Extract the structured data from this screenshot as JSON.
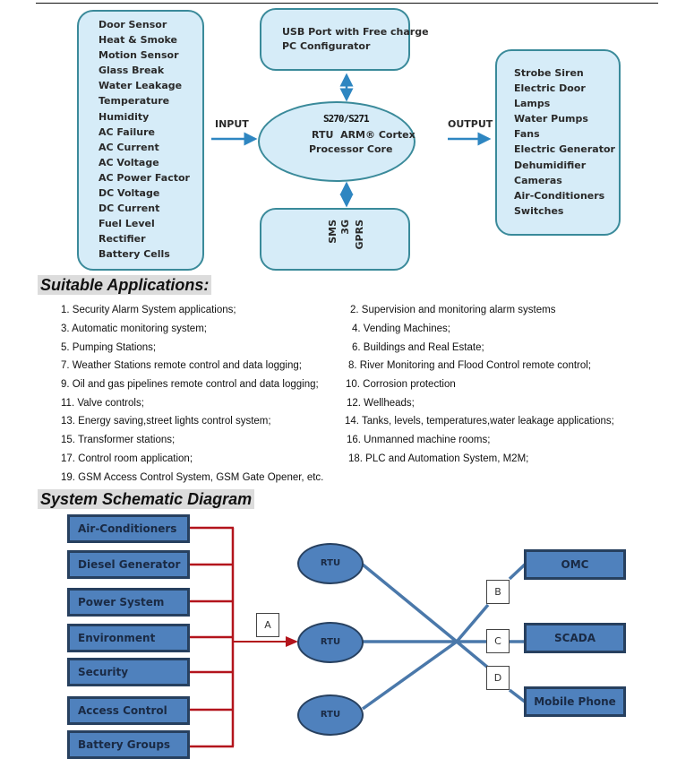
{
  "block_diagram": {
    "inputs": [
      "Door Sensor",
      "Heat & Smoke",
      "Motion Sensor",
      "Glass Break",
      "Water Leakage",
      "Temperature",
      "Humidity",
      "AC Failure",
      "AC Current",
      "AC Voltage",
      "AC Power Factor",
      "DC Voltage",
      "DC Current",
      "Fuel Level",
      "Rectifier",
      "Battery Cells"
    ],
    "input_label": "INPUT",
    "output_label": "OUTPUT",
    "usb_box": {
      "line1": "USB Port with Free charge",
      "line2": "PC Configurator"
    },
    "core": {
      "model": "S270/S271",
      "line2": "RTU  ARM® Cortex",
      "line3": "Processor Core"
    },
    "comm": [
      "GPRS",
      "3G",
      "SMS"
    ],
    "outputs": [
      "Strobe Siren",
      "Electric Door",
      "Lamps",
      "Water Pumps",
      "Fans",
      "Electric Generator",
      "Dehumidifier",
      "Cameras",
      "Air-Conditioners",
      "Switches"
    ],
    "colors": {
      "box_fill": "#d6ecf8",
      "box_border": "#3a8a9a",
      "arrow": "#2e86c1"
    }
  },
  "applications": {
    "title": "Suitable Applications:",
    "items": [
      "1. Security Alarm System applications;",
      "2. Supervision and monitoring alarm systems",
      "3. Automatic monitoring system;",
      "4. Vending Machines;",
      "5. Pumping Stations;",
      "6. Buildings and Real Estate;",
      "7. Weather Stations remote control and data logging;",
      "8. River Monitoring and Flood Control remote control;",
      "9. Oil and gas pipelines remote control and data logging;",
      "10. Corrosion protection",
      "11. Valve controls;",
      "12. Wellheads;",
      "13. Energy saving,street lights control system;",
      "14. Tanks, levels, temperatures,water leakage applications;",
      "15. Transformer stations;",
      "16. Unmanned machine rooms;",
      "17. Control room application;",
      "18. PLC and Automation System, M2M;",
      "19. GSM Access Control System, GSM Gate Opener, etc."
    ]
  },
  "schematic": {
    "title": "System Schematic Diagram",
    "sources": [
      "Air-Conditioners",
      "Diesel Generator",
      "Power System",
      "Environment",
      "Security",
      "Access Control",
      "Battery Groups"
    ],
    "rtu_label": "RTU",
    "rtus": [
      "RTU",
      "RTU",
      "RTU"
    ],
    "tags": {
      "a": "A",
      "b": "B",
      "c": "C",
      "d": "D"
    },
    "destinations": [
      "OMC",
      "SCADA",
      "Mobile Phone"
    ],
    "colors": {
      "block_fill": "#4f81bd",
      "block_border": "#27405f",
      "bus_line": "#b3141c",
      "link_line": "#4a78aa"
    }
  }
}
